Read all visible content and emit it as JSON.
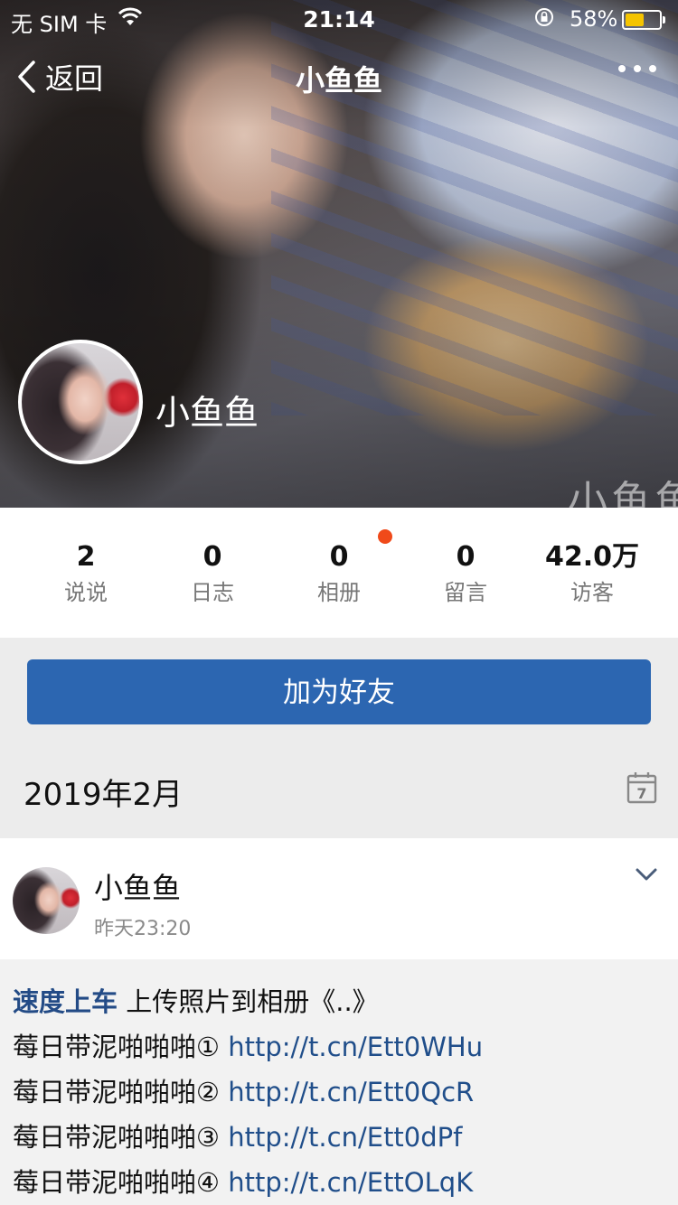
{
  "status_bar": {
    "carrier": "无 SIM 卡",
    "time": "21:14",
    "battery_text": "58%",
    "battery_level": 0.58,
    "battery_color": "#f5c400"
  },
  "nav": {
    "back_label": "返回",
    "title": "小鱼鱼",
    "back_icon": "chevron-left-icon",
    "more_icon": "more-dots-icon"
  },
  "cover": {
    "watermark": "小鱼鱼"
  },
  "profile": {
    "name": "小鱼鱼"
  },
  "stats": [
    {
      "value": "2",
      "label": "说说"
    },
    {
      "value": "0",
      "label": "日志"
    },
    {
      "value": "0",
      "label": "相册"
    },
    {
      "value": "0",
      "label": "留言"
    },
    {
      "value": "42.0万",
      "label": "访客"
    }
  ],
  "add_friend": {
    "label": "加为好友",
    "color": "#2c66b1"
  },
  "date_section": {
    "label": "2019年2月",
    "calendar_day": "7"
  },
  "post": {
    "author": "小鱼鱼",
    "time": "昨天23:20",
    "action_user": "速度上车",
    "action_text": " 上传照片到相册《..》",
    "lines": [
      {
        "text": "莓日带泥啪啪啪①",
        "link": "http://t.cn/Ett0WHu"
      },
      {
        "text": "莓日带泥啪啪啪②",
        "link": "http://t.cn/Ett0QcR"
      },
      {
        "text": "莓日带泥啪啪啪③",
        "link": "http://t.cn/Ett0dPf"
      },
      {
        "text": "莓日带泥啪啪啪④",
        "link": "http://t.cn/EttOLqK"
      }
    ]
  }
}
